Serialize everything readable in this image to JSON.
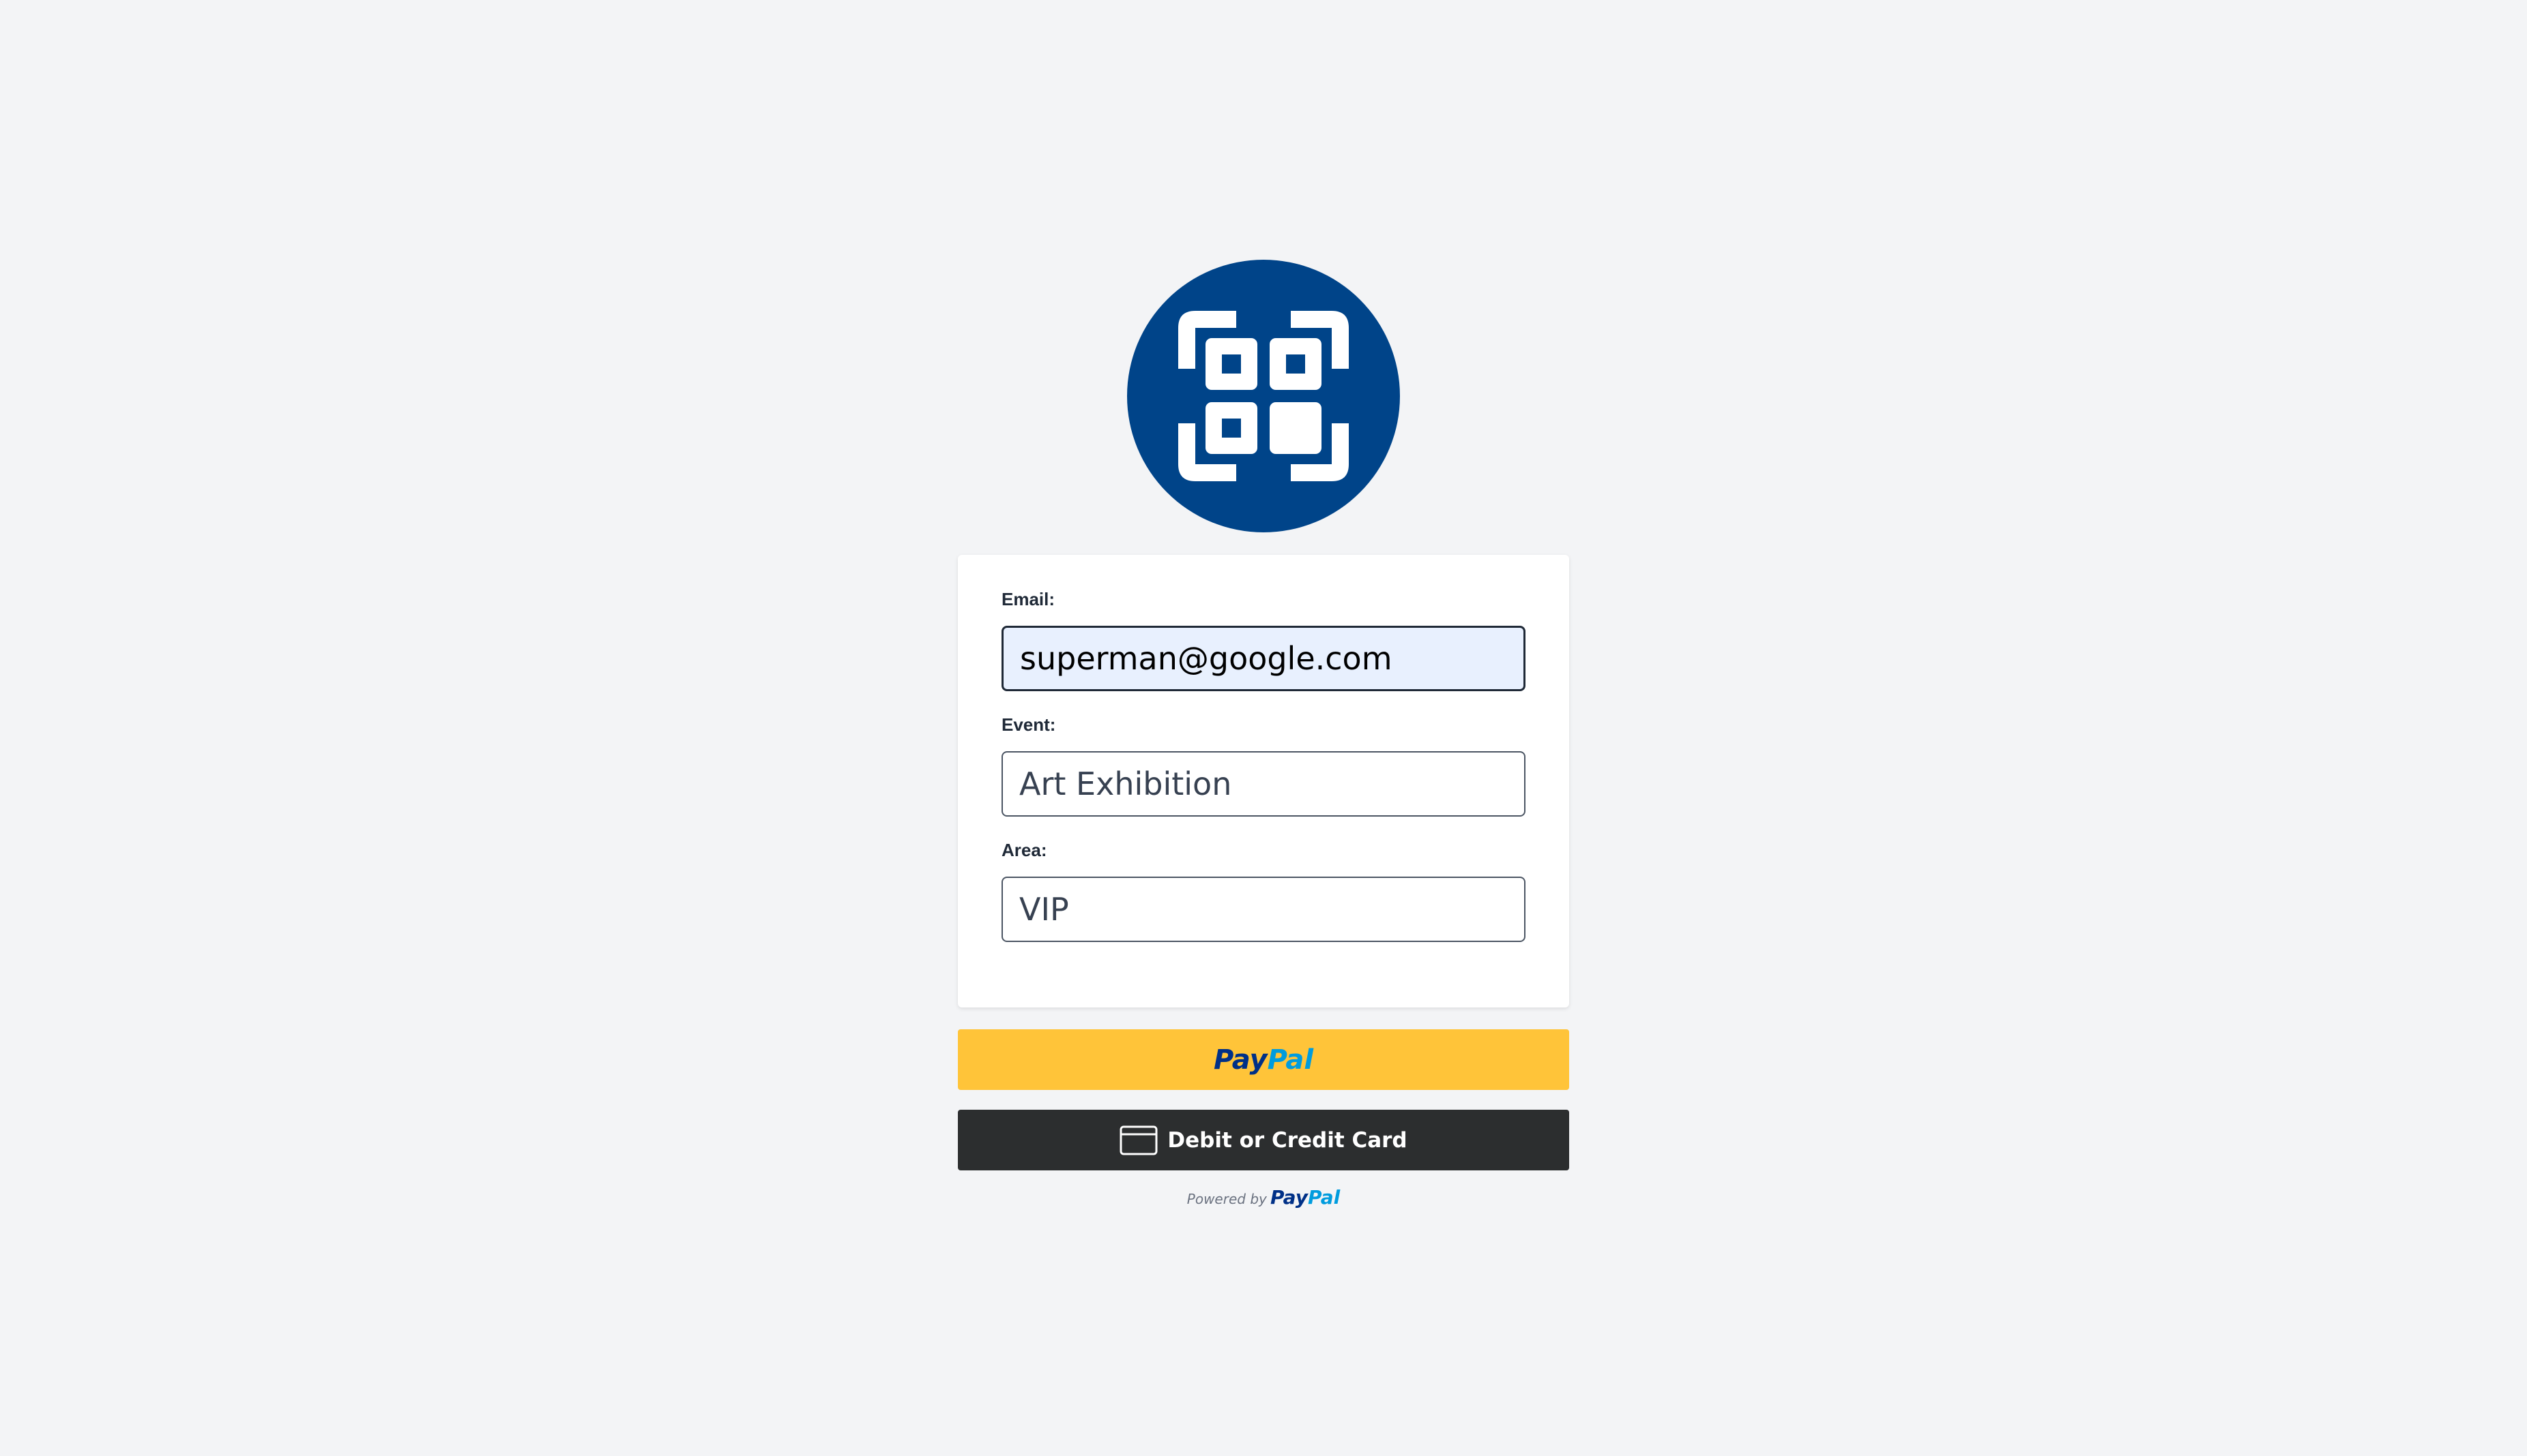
{
  "colors": {
    "page_background": "#f3f4f6",
    "logo_background": "#004489",
    "paypal_yellow": "#ffc439",
    "card_button_dark": "#2c2e2f",
    "paypal_dark_blue": "#003087",
    "paypal_light_blue": "#009cde",
    "autofill_blue": "#e8f0fe"
  },
  "logo": {
    "icon": "qr-code-scan-icon"
  },
  "form": {
    "email": {
      "label": "Email:",
      "value": "superman@google.com"
    },
    "event": {
      "label": "Event:",
      "value": "Art Exhibition"
    },
    "area": {
      "label": "Area:",
      "value": "VIP"
    }
  },
  "payment": {
    "paypal_button": {
      "brand_part1": "Pay",
      "brand_part2": "Pal"
    },
    "card_button": {
      "label": "Debit or Credit Card",
      "icon": "credit-card-icon"
    },
    "powered_by": {
      "prefix": "Powered by",
      "brand_part1": "Pay",
      "brand_part2": "Pal"
    }
  }
}
